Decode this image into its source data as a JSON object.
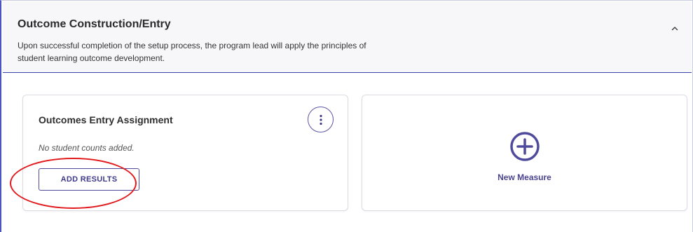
{
  "section": {
    "title": "Outcome Construction/Entry",
    "description": "Upon successful completion of the setup process, the program lead will apply the principles of student learning outcome development.",
    "collapse_icon": "chevron-up-icon"
  },
  "assignment_card": {
    "title": "Outcomes Entry Assignment",
    "note": "No student counts added.",
    "add_results_label": "ADD RESULTS",
    "menu_icon": "more-vertical-icon"
  },
  "new_measure_card": {
    "label": "New Measure",
    "icon": "plus-circle-icon"
  },
  "colors": {
    "accent": "#4f4a9c",
    "header_border": "#3b45a8",
    "highlight": "#e2191c"
  }
}
